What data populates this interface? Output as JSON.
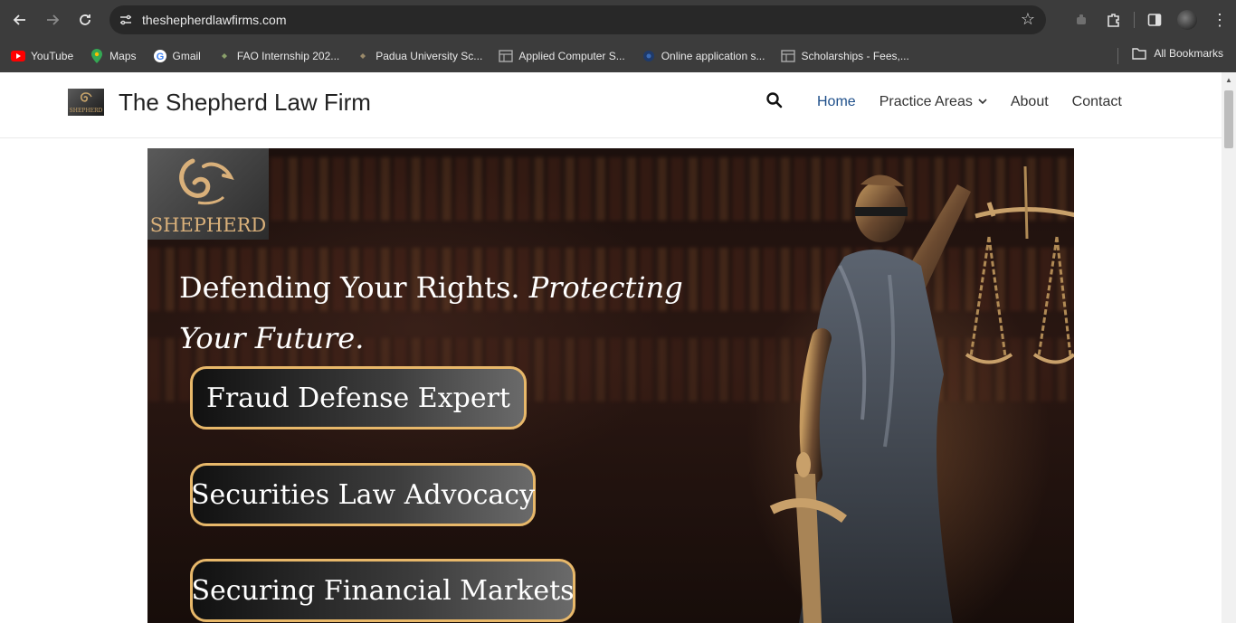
{
  "browser": {
    "url": "theshepherdlawfirms.com",
    "bookmarks": [
      {
        "label": "YouTube",
        "icon": "youtube-icon"
      },
      {
        "label": "Maps",
        "icon": "maps-icon"
      },
      {
        "label": "Gmail",
        "icon": "google-icon"
      },
      {
        "label": "FAO Internship 202...",
        "icon": "site-icon"
      },
      {
        "label": "Padua University Sc...",
        "icon": "site-icon"
      },
      {
        "label": "Applied Computer S...",
        "icon": "doc-icon"
      },
      {
        "label": "Online application s...",
        "icon": "globe-icon"
      },
      {
        "label": "Scholarships - Fees,...",
        "icon": "doc-icon"
      }
    ],
    "all_bookmarks": "All Bookmarks"
  },
  "site": {
    "title": "The Shepherd Law Firm",
    "logo_text": "SHEPHERD",
    "nav": [
      {
        "label": "Home",
        "active": true
      },
      {
        "label": "Practice Areas",
        "active": false,
        "has_dropdown": true
      },
      {
        "label": "About",
        "active": false
      },
      {
        "label": "Contact",
        "active": false
      }
    ]
  },
  "hero": {
    "logo_word": "SHEPHERD",
    "headline_plain": "Defending Your Rights. ",
    "headline_italic_1": "Protecting",
    "headline_italic_2": "Your Future.",
    "pills": [
      "Fraud Defense Expert",
      "Securities Law Advocacy",
      "Securing Financial Markets"
    ]
  },
  "colors": {
    "chrome_bg": "#3c3c3c",
    "nav_active": "#1e4f8a",
    "pill_border": "#e8b86a",
    "logo_gold": "#d9b07a"
  }
}
